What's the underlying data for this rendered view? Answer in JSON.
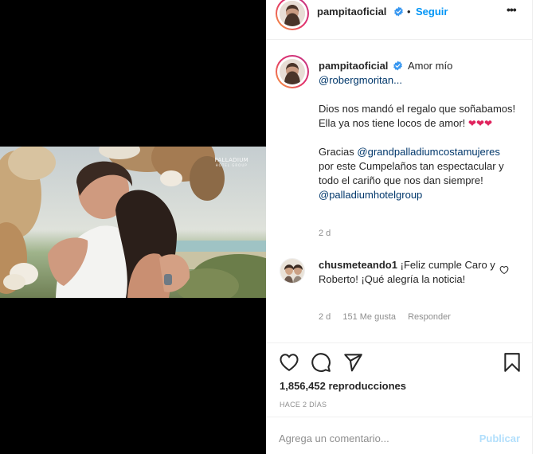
{
  "post": {
    "author": "pampitaoficial",
    "follow_label": "Seguir",
    "separator": "•",
    "more_icon": "more-horizontal-icon",
    "verified_icon": "verified-badge-icon"
  },
  "media": {
    "watermark": "PALLADIUM",
    "watermark_sub": "HOTEL GROUP"
  },
  "caption": {
    "author": "pampitaoficial",
    "line1_text": "Amor mío",
    "line1_mention": "@robergmoritan...",
    "para2": "Dios nos mandó el regalo que soñabamos! Ella ya nos tiene locos de amor!",
    "hearts": "❤❤❤",
    "para3_prefix": "Gracias",
    "para3_mention": "@grandpalladiumcostamujeres",
    "para3_text": "por este Cumpelaños tan espectacular y todo el cariño que nos dan siempre!",
    "para3_mention2": "@palladiumhotelgroup",
    "age": "2 d"
  },
  "comment": {
    "author": "chusmeteando1",
    "text": "¡Feliz cumple Caro y Roberto! ¡Qué alegría la noticia!",
    "age": "2 d",
    "likes": "151 Me gusta",
    "reply_label": "Responder",
    "like_icon": "heart-outline-icon"
  },
  "actions": {
    "like_icon": "heart-outline-icon",
    "comment_icon": "comment-bubble-icon",
    "share_icon": "paper-plane-icon",
    "save_icon": "bookmark-icon",
    "views": "1,856,452 reproducciones",
    "time_ago": "HACE 2 DÍAS"
  },
  "composer": {
    "placeholder": "Agrega un comentario...",
    "publish_label": "Publicar"
  },
  "colors": {
    "link": "#00376b",
    "follow": "#0095f6",
    "publish_disabled": "#b2dffc",
    "muted": "#8e8e8e"
  }
}
